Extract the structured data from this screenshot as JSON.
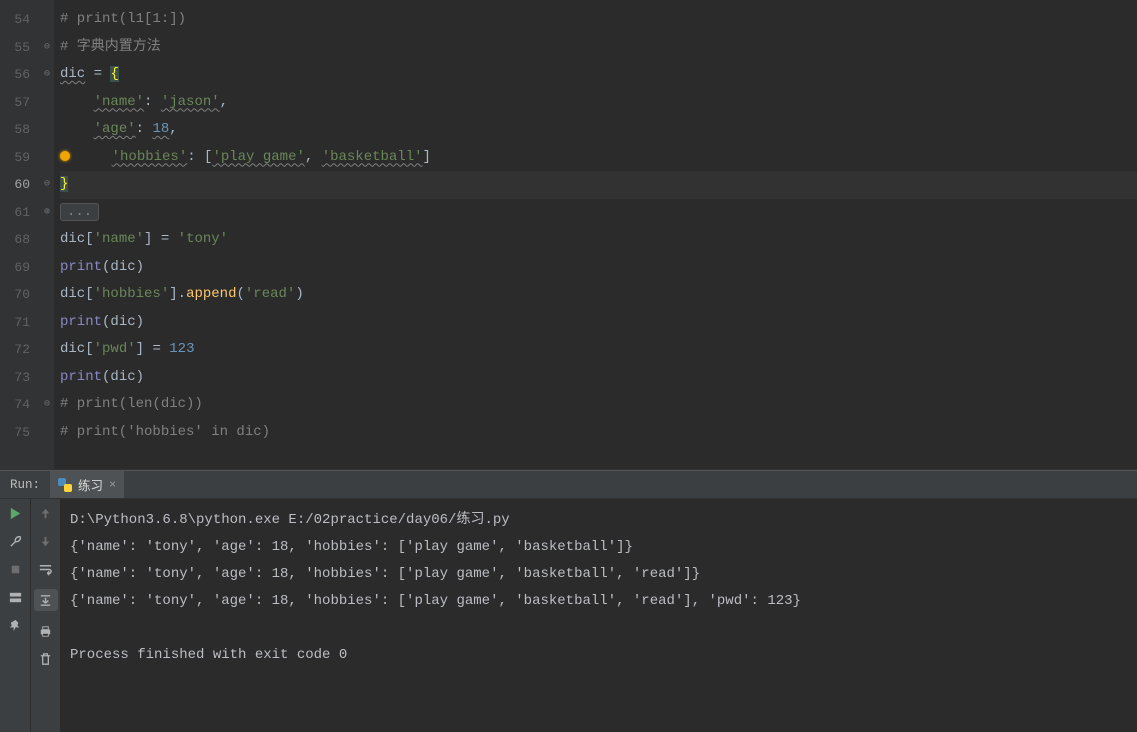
{
  "editor": {
    "lines": [
      {
        "n": "54",
        "indent": "",
        "tokens": [
          {
            "t": "# print(l1[1:])",
            "c": "cmt"
          }
        ]
      },
      {
        "n": "55",
        "indent": "",
        "fold": "⊖",
        "tokens": [
          {
            "t": "# 字典内置方法",
            "c": "cmt"
          }
        ]
      },
      {
        "n": "56",
        "indent": "",
        "fold": "⊖",
        "tokens": [
          {
            "t": "dic",
            "c": "id wavy"
          },
          {
            "t": " ",
            "c": "op"
          },
          {
            "t": "=",
            "c": "op"
          },
          {
            "t": " ",
            "c": "op"
          },
          {
            "t": "{",
            "c": "brace-hl"
          }
        ]
      },
      {
        "n": "57",
        "indent": "    ",
        "tokens": [
          {
            "t": "'name'",
            "c": "str wavy"
          },
          {
            "t": ":",
            "c": "pn"
          },
          {
            "t": " ",
            "c": "op"
          },
          {
            "t": "'jason'",
            "c": "str wavy"
          },
          {
            "t": ",",
            "c": "pn"
          }
        ]
      },
      {
        "n": "58",
        "indent": "    ",
        "tokens": [
          {
            "t": "'age'",
            "c": "str wavy"
          },
          {
            "t": ":",
            "c": "pn"
          },
          {
            "t": " ",
            "c": "op"
          },
          {
            "t": "18",
            "c": "num wavy"
          },
          {
            "t": ",",
            "c": "pn"
          }
        ]
      },
      {
        "n": "59",
        "indent": "    ",
        "bulb": true,
        "tokens": [
          {
            "t": "'hobbies'",
            "c": "str wavy"
          },
          {
            "t": ":",
            "c": "pn"
          },
          {
            "t": " ",
            "c": "op"
          },
          {
            "t": "[",
            "c": "pn"
          },
          {
            "t": "'play game'",
            "c": "str wavy"
          },
          {
            "t": ",",
            "c": "pn"
          },
          {
            "t": " ",
            "c": "op"
          },
          {
            "t": "'basketball'",
            "c": "str wavy"
          },
          {
            "t": "]",
            "c": "pn"
          }
        ]
      },
      {
        "n": "60",
        "current": true,
        "indent": "",
        "fold": "⊖",
        "tokens": [
          {
            "t": "}",
            "c": "brace-hl"
          }
        ]
      },
      {
        "n": "61",
        "indent": "",
        "fold": "⊕",
        "badge": "..."
      },
      {
        "n": "68",
        "indent": "",
        "tokens": [
          {
            "t": "dic",
            "c": "id"
          },
          {
            "t": "[",
            "c": "pn"
          },
          {
            "t": "'name'",
            "c": "str"
          },
          {
            "t": "]",
            "c": "pn"
          },
          {
            "t": " = ",
            "c": "op"
          },
          {
            "t": "'tony'",
            "c": "str"
          }
        ]
      },
      {
        "n": "69",
        "indent": "",
        "tokens": [
          {
            "t": "print",
            "c": "built"
          },
          {
            "t": "(",
            "c": "pn"
          },
          {
            "t": "dic",
            "c": "id"
          },
          {
            "t": ")",
            "c": "pn"
          }
        ]
      },
      {
        "n": "70",
        "indent": "",
        "tokens": [
          {
            "t": "dic",
            "c": "id"
          },
          {
            "t": "[",
            "c": "pn"
          },
          {
            "t": "'hobbies'",
            "c": "str"
          },
          {
            "t": "]",
            "c": "pn"
          },
          {
            "t": ".",
            "c": "pn"
          },
          {
            "t": "append",
            "c": "fn"
          },
          {
            "t": "(",
            "c": "pn"
          },
          {
            "t": "'read'",
            "c": "str"
          },
          {
            "t": ")",
            "c": "pn"
          }
        ]
      },
      {
        "n": "71",
        "indent": "",
        "tokens": [
          {
            "t": "print",
            "c": "built"
          },
          {
            "t": "(",
            "c": "pn"
          },
          {
            "t": "dic",
            "c": "id"
          },
          {
            "t": ")",
            "c": "pn"
          }
        ]
      },
      {
        "n": "72",
        "indent": "",
        "tokens": [
          {
            "t": "dic",
            "c": "id"
          },
          {
            "t": "[",
            "c": "pn"
          },
          {
            "t": "'pwd'",
            "c": "str"
          },
          {
            "t": "]",
            "c": "pn"
          },
          {
            "t": " = ",
            "c": "op"
          },
          {
            "t": "123",
            "c": "num"
          }
        ]
      },
      {
        "n": "73",
        "indent": "",
        "tokens": [
          {
            "t": "print",
            "c": "built"
          },
          {
            "t": "(",
            "c": "pn"
          },
          {
            "t": "dic",
            "c": "id"
          },
          {
            "t": ")",
            "c": "pn"
          }
        ]
      },
      {
        "n": "74",
        "indent": "",
        "fold": "⊖",
        "tokens": [
          {
            "t": "# print(len(dic))",
            "c": "cmt"
          }
        ]
      },
      {
        "n": "75",
        "indent": "",
        "tokens": [
          {
            "t": "# print('hobbies' in dic)",
            "c": "cmt"
          }
        ]
      }
    ]
  },
  "run": {
    "label": "Run:",
    "tab_name": "练习",
    "console_lines": [
      "D:\\Python3.6.8\\python.exe E:/02practice/day06/练习.py",
      "{'name': 'tony', 'age': 18, 'hobbies': ['play game', 'basketball']}",
      "{'name': 'tony', 'age': 18, 'hobbies': ['play game', 'basketball', 'read']}",
      "{'name': 'tony', 'age': 18, 'hobbies': ['play game', 'basketball', 'read'], 'pwd': 123}",
      "",
      "Process finished with exit code 0"
    ]
  }
}
